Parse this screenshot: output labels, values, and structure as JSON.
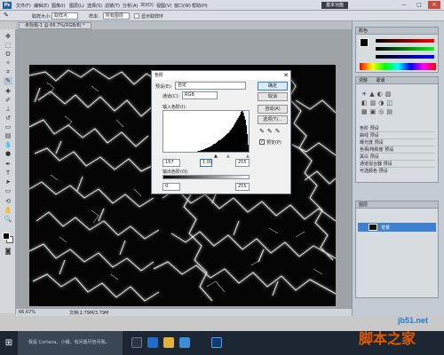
{
  "menubar": {
    "app_logo": "Ps",
    "items": [
      "文件(F)",
      "编辑(E)",
      "图像(I)",
      "图层(L)",
      "选择(S)",
      "滤镜(T)",
      "分析(A)",
      "3D(D)",
      "视图(V)",
      "窗口(W)",
      "帮助(H)"
    ],
    "workspace": "基本功能",
    "min": "—",
    "max": "□",
    "close": "✕"
  },
  "optbar": {
    "sample_size_label": "取样大小:",
    "sample_size_value": "取样点",
    "sample_label": "样本:",
    "sample_value": "所有图层",
    "show_ring": "显示取样环"
  },
  "document": {
    "tab_title": "未标题-1 @ 66.7%(RGB/8) *"
  },
  "status": {
    "zoom": "66.67%",
    "doc_info": "文档:2.79M/3.79M"
  },
  "dialog": {
    "title": "色阶",
    "preset_label": "预设(E):",
    "preset_value": "自定",
    "channel_label": "通道(C):",
    "channel_value": "RGB",
    "input_label": "输入色阶(I):",
    "input_shadow": "157",
    "input_mid": "1.00",
    "input_highlight": "255",
    "output_label": "输出色阶(O):",
    "output_low": "0",
    "output_high": "255",
    "ok": "确定",
    "cancel": "取消",
    "auto": "自动(A)",
    "options": "选项(T)...",
    "preview": "预览(P)"
  },
  "panels": {
    "swatch_tabs": [
      "颜色",
      "色板",
      "样式"
    ],
    "adjust_tabs": [
      "调整",
      "蒙版"
    ],
    "presets": [
      "色阶 预设",
      "曲线 预设",
      "曝光度 预设",
      "色相/饱和度 预设",
      "黑白 预设",
      "通道混合器 预设",
      "可选颜色 预设"
    ],
    "layer_tabs": [
      "图层",
      "通道",
      "路径"
    ],
    "layer_name": "背景"
  },
  "taskbar": {
    "search_placeholder": "我是 Cortana，小娜。有问题尽管问我。"
  },
  "watermark": {
    "site": "jb51.net",
    "brand": "脚本之家"
  },
  "histogram": {
    "heights": [
      0,
      0,
      0,
      0,
      0,
      0,
      0,
      0,
      0,
      0,
      0,
      0,
      0,
      0,
      0,
      0,
      0,
      0,
      0,
      0,
      0,
      0,
      0,
      0,
      0,
      0,
      0,
      0,
      0,
      0,
      0,
      0,
      0,
      0,
      1,
      1,
      1,
      2,
      2,
      2,
      3,
      3,
      4,
      4,
      5,
      5,
      6,
      6,
      7,
      8,
      9,
      9,
      10,
      11,
      12,
      13,
      13,
      14,
      15,
      16,
      17,
      18,
      19,
      20,
      21,
      22,
      24,
      25,
      27,
      28,
      30,
      32,
      34,
      36,
      38,
      40,
      42,
      45,
      47,
      44,
      40,
      36,
      30,
      20,
      8
    ]
  }
}
